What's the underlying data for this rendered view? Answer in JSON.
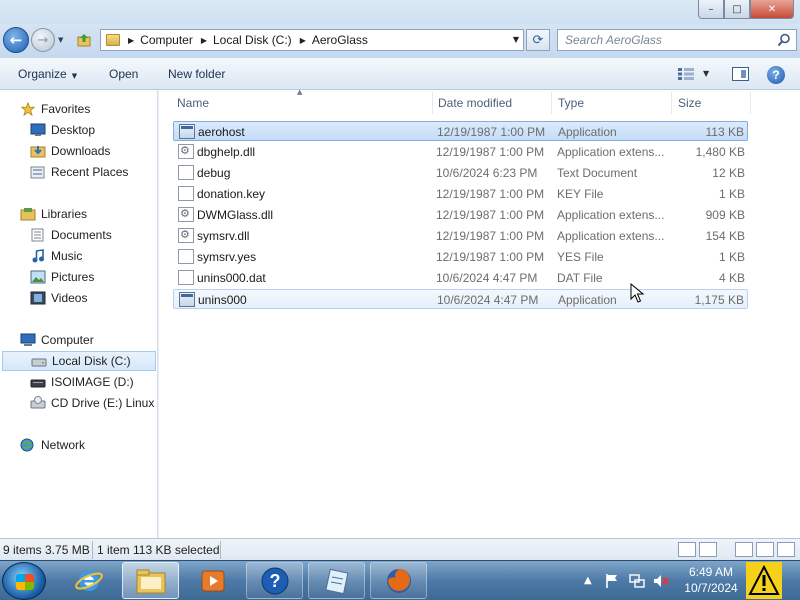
{
  "window": {
    "caption": {
      "minimize": "–",
      "maximize": "□",
      "close": "✕"
    }
  },
  "address_bar": {
    "back_icon": "back-arrow-icon",
    "forward_icon": "forward-arrow-icon",
    "breadcrumbs": [
      "Computer",
      "Local Disk (C:)",
      "AeroGlass"
    ],
    "search_placeholder": "Search AeroGlass"
  },
  "command_bar": {
    "organize": "Organize",
    "open": "Open",
    "new_folder": "New folder"
  },
  "sidebar": {
    "favorites": {
      "label": "Favorites",
      "items": [
        "Desktop",
        "Downloads",
        "Recent Places"
      ]
    },
    "libraries": {
      "label": "Libraries",
      "items": [
        "Documents",
        "Music",
        "Pictures",
        "Videos"
      ]
    },
    "computer": {
      "label": "Computer",
      "items": [
        "Local Disk (C:)",
        "ISOIMAGE (D:)",
        "CD Drive (E:) Linux M"
      ]
    },
    "network": {
      "label": "Network"
    }
  },
  "columns": {
    "name": "Name",
    "date": "Date modified",
    "type": "Type",
    "size": "Size"
  },
  "files": [
    {
      "name": "aerohost",
      "date": "12/19/1987 1:00 PM",
      "type": "Application",
      "size": "113 KB",
      "icon": "application-icon"
    },
    {
      "name": "dbghelp.dll",
      "date": "12/19/1987 1:00 PM",
      "type": "Application extens...",
      "size": "1,480 KB",
      "icon": "dll-icon"
    },
    {
      "name": "debug",
      "date": "10/6/2024 6:23 PM",
      "type": "Text Document",
      "size": "12 KB",
      "icon": "text-file-icon"
    },
    {
      "name": "donation.key",
      "date": "12/19/1987 1:00 PM",
      "type": "KEY File",
      "size": "1 KB",
      "icon": "file-icon"
    },
    {
      "name": "DWMGlass.dll",
      "date": "12/19/1987 1:00 PM",
      "type": "Application extens...",
      "size": "909 KB",
      "icon": "dll-icon"
    },
    {
      "name": "symsrv.dll",
      "date": "12/19/1987 1:00 PM",
      "type": "Application extens...",
      "size": "154 KB",
      "icon": "dll-icon"
    },
    {
      "name": "symsrv.yes",
      "date": "12/19/1987 1:00 PM",
      "type": "YES File",
      "size": "1 KB",
      "icon": "file-icon"
    },
    {
      "name": "unins000.dat",
      "date": "10/6/2024 4:47 PM",
      "type": "DAT File",
      "size": "4 KB",
      "icon": "file-icon"
    },
    {
      "name": "unins000",
      "date": "10/6/2024 4:47 PM",
      "type": "Application",
      "size": "1,175 KB",
      "icon": "uninstaller-icon"
    }
  ],
  "status": {
    "items": "9 items 3.75 MB",
    "selected": "1 item 113 KB selected"
  },
  "taskbar": {
    "time": "6:49 AM",
    "date": "10/7/2024",
    "accent": "#4e7aa7"
  }
}
